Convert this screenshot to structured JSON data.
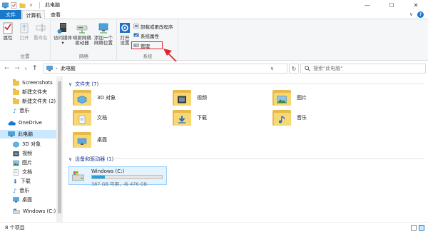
{
  "titlebar": {
    "title": "此电脑",
    "controls": {
      "minimize": "—",
      "maximize": "☐",
      "close": "✕"
    }
  },
  "tabs": {
    "file": "文件",
    "computer": "计算机",
    "view": "查看"
  },
  "ribbon": {
    "location_group": {
      "label": "位置",
      "properties": "属性",
      "open": "打开",
      "rename": "重命名"
    },
    "network_group": {
      "label": "网络",
      "access_media": "访问媒体",
      "map_drive_line1": "映射网络",
      "map_drive_line2": "驱动器",
      "add_location_line1": "添加一个",
      "add_location_line2": "网络位置"
    },
    "system_group": {
      "label": "系统",
      "open_settings_line1": "打开",
      "open_settings_line2": "设置",
      "uninstall": "卸载或更改程序",
      "system_properties": "系统属性",
      "manage": "管理"
    }
  },
  "address": {
    "path": "此电脑",
    "search_placeholder": "搜索\"此电脑\""
  },
  "nav": {
    "items": [
      {
        "label": "Screenshots",
        "icon": "folder-icon"
      },
      {
        "label": "新建文件夹",
        "icon": "folder-icon"
      },
      {
        "label": "新建文件夹 (2)",
        "icon": "folder-icon"
      },
      {
        "label": "音乐",
        "icon": "music-icon"
      },
      {
        "label": "OneDrive",
        "icon": "cloud-icon"
      },
      {
        "label": "此电脑",
        "icon": "computer-icon"
      },
      {
        "label": "3D 对象",
        "icon": "cube-icon"
      },
      {
        "label": "视频",
        "icon": "video-icon"
      },
      {
        "label": "图片",
        "icon": "picture-icon"
      },
      {
        "label": "文档",
        "icon": "document-icon"
      },
      {
        "label": "下载",
        "icon": "download-icon"
      },
      {
        "label": "音乐",
        "icon": "music-icon"
      },
      {
        "label": "桌面",
        "icon": "desktop-icon"
      },
      {
        "label": "Windows (C:)",
        "icon": "drive-icon"
      }
    ]
  },
  "content": {
    "folders_header": "文件夹 (7)",
    "folders": [
      {
        "label": "3D 对象",
        "badge": "cube"
      },
      {
        "label": "视频",
        "badge": "video"
      },
      {
        "label": "图片",
        "badge": "picture"
      },
      {
        "label": "文档",
        "badge": "document"
      },
      {
        "label": "下载",
        "badge": "download"
      },
      {
        "label": "音乐",
        "badge": "music"
      },
      {
        "label": "桌面",
        "badge": "desktop"
      }
    ],
    "devices_header": "设备和驱动器 (1)",
    "drive": {
      "name": "Windows (C:)",
      "free_text": "387 GB 可用，共 476 GB",
      "used_fraction": 0.187
    }
  },
  "status": {
    "item_count": "8 个项目"
  },
  "colors": {
    "accent": "#1979ca",
    "highlight_box": "#e0262c",
    "folder": "#f8d775",
    "selection": "#cce8ff"
  }
}
